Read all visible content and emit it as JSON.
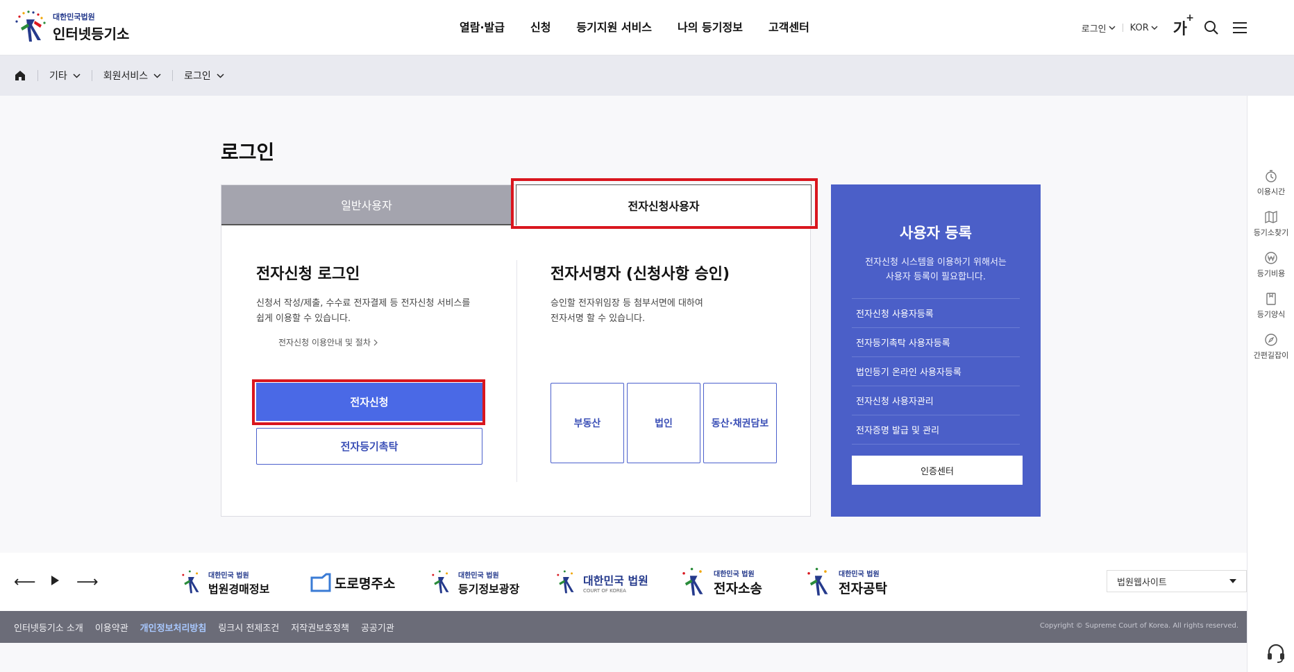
{
  "header": {
    "logo_small": "대한민국법원",
    "logo_big": "인터넷등기소",
    "nav": [
      "열람·발급",
      "신청",
      "등기지원 서비스",
      "나의 등기정보",
      "고객센터"
    ],
    "login_dd": "로그인",
    "lang_dd": "KOR",
    "font_btn": "가",
    "font_plus": "+"
  },
  "breadcrumb": {
    "items": [
      "기타",
      "회원서비스",
      "로그인"
    ]
  },
  "quick_menu": [
    "이용시간",
    "등기소찾기",
    "등기비용",
    "등기양식",
    "간편길잡이"
  ],
  "main": {
    "title": "로그인",
    "tabs": [
      "일반사용자",
      "전자신청사용자"
    ],
    "left": {
      "title": "전자신청 로그인",
      "desc": "신청서 작성/제출, 수수료 전자결제 등 전자신청 서비스를\n쉽게 이용할 수 있습니다.",
      "link": "전자신청 이용안내 및 절차",
      "btn_primary": "전자신청",
      "btn_secondary": "전자등기촉탁"
    },
    "right": {
      "title": "전자서명자 (신청사항 승인)",
      "desc": "승인할 전자위임장 등 첨부서면에 대하여\n전자서명 할 수 있습니다.",
      "buttons": [
        "부동산",
        "법인",
        "동산·채권담보"
      ]
    }
  },
  "register": {
    "title": "사용자 등록",
    "desc": "전자신청 시스템을 이용하기 위해서는\n사용자 등록이 필요합니다.",
    "items": [
      "전자신청 사용자등록",
      "전자등기촉탁 사용자등록",
      "법인등기 온라인 사용자등록",
      "전자신청 사용자관리",
      "전자증명 발급 및 관리"
    ],
    "button": "인증센터"
  },
  "banner": {
    "logos": [
      {
        "small": "대한민국 법원",
        "big": "법원경매정보"
      },
      {
        "big": "도로명주소"
      },
      {
        "small": "대한민국 법원",
        "big": "등기정보광장"
      },
      {
        "small": "대한민국 법원",
        "tiny": "COURT OF KOREA"
      },
      {
        "small": "대한민국 법원",
        "big": "전자소송"
      },
      {
        "small": "대한민국 법원",
        "big": "전자공탁"
      }
    ],
    "select": "법원웹사이트"
  },
  "footer": {
    "links": [
      "인터넷등기소 소개",
      "이용약관",
      "개인정보처리방침",
      "링크시 전제조건",
      "저작권보호정책",
      "공공기관"
    ],
    "copyright": "Copyright © Supreme Court of Korea. All rights reserved."
  },
  "colors": {
    "primary": "#4a69e6",
    "register_bg": "#4b5fc8",
    "highlight": "#d9161e",
    "footer_bg": "#6b6c78"
  }
}
